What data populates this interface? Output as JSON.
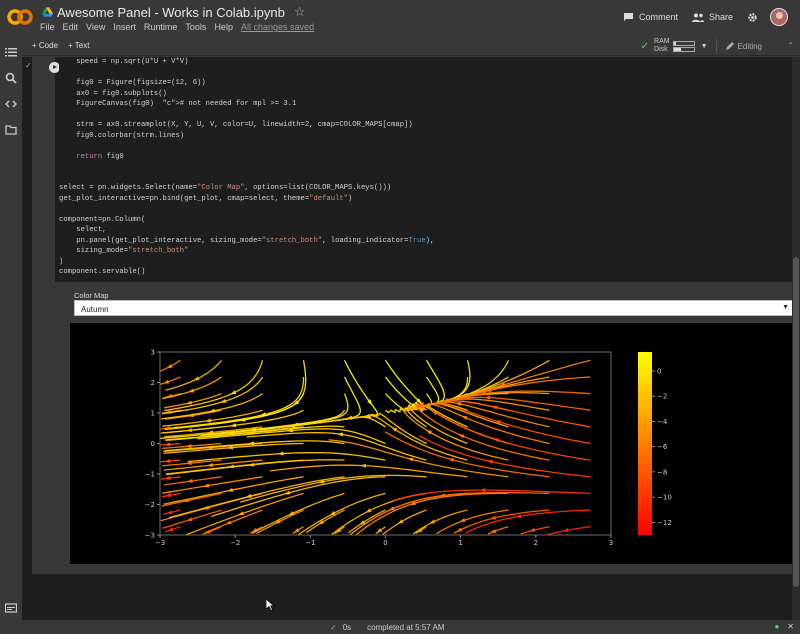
{
  "app": {
    "doc_title": "Awesome Panel - Works in Colab.ipynb",
    "menu": [
      "File",
      "Edit",
      "View",
      "Insert",
      "Runtime",
      "Tools",
      "Help"
    ],
    "saved_status": "All changes saved",
    "comment_label": "Comment",
    "share_label": "Share"
  },
  "toolbar": {
    "add_code": "+ Code",
    "add_text": "+ Text",
    "ram_label": "RAM",
    "disk_label": "Disk",
    "ram_fill": 0.1,
    "disk_fill": 0.35,
    "editing_label": "Editing"
  },
  "code_lines": [
    "    speed = np.sqrt(U*U + V*V)",
    "",
    "    fig0 = Figure(figsize=(12, 6))",
    "    ax0 = fig0.subplots()",
    "    FigureCanvas(fig0)  # not needed for mpl >= 3.1",
    "",
    "    strm = ax0.streamplot(X, Y, U, V, color=U, linewidth=2, cmap=COLOR_MAPS[cmap])",
    "    fig0.colorbar(strm.lines)",
    "",
    "    return fig0",
    "",
    "",
    "select = pn.widgets.Select(name=\"Color Map\", options=list(COLOR_MAPS.keys()))",
    "get_plot_interactive=pn.bind(get_plot, cmap=select, theme=\"default\")",
    "",
    "component=pn.Column(",
    "    select,",
    "    pn.panel(get_plot_interactive, sizing_mode=\"stretch_both\", loading_indicator=True),",
    "    sizing_mode=\"stretch_both\"",
    ")",
    "component.servable()"
  ],
  "widget": {
    "label": "Color Map",
    "selected": "Autumn"
  },
  "chart_data": {
    "type": "streamplot",
    "xlim": [
      -3,
      3
    ],
    "ylim": [
      -3,
      3
    ],
    "xticks": [
      "−3",
      "−2",
      "−1",
      "0",
      "1",
      "2",
      "3"
    ],
    "yticks": [
      "−3",
      "−2",
      "−1",
      "0",
      "1",
      "2",
      "3"
    ],
    "colormap": "autumn",
    "colorbar_ticks": [
      "0",
      "−2",
      "−4",
      "−6",
      "−8",
      "−10",
      "−12"
    ],
    "colorbar_range": [
      -13,
      1.5
    ],
    "background": "#000000"
  },
  "status": {
    "duration": "0s",
    "message": "completed at 5:57 AM"
  },
  "colors": {
    "accent_green": "#66cc66",
    "colab_orange": "#f9ab00"
  }
}
